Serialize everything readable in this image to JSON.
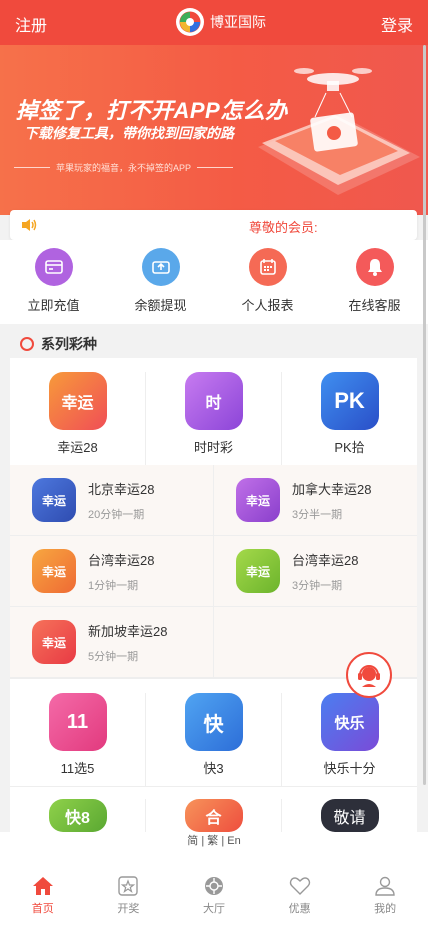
{
  "header": {
    "register": "注册",
    "title": "博亚国际",
    "login": "登录"
  },
  "banner": {
    "headline": "掉签了，打不开APP怎么办",
    "subline": "下载修复工具，带你找到回家的路",
    "tagline": "苹果玩家的福音，永不掉签的APP"
  },
  "notice": {
    "text": "尊敬的会员:"
  },
  "actions": [
    {
      "label": "立即充值",
      "icon": "recharge-icon",
      "color": "#b063e0"
    },
    {
      "label": "余额提现",
      "icon": "withdraw-icon",
      "color": "#5aa8ea"
    },
    {
      "label": "个人报表",
      "icon": "report-icon",
      "color": "#f56a55"
    },
    {
      "label": "在线客服",
      "icon": "service-icon",
      "color": "#f45a5a"
    }
  ],
  "section": {
    "title": "系列彩种"
  },
  "lottery_top": [
    {
      "name": "幸运28",
      "icon_text": "幸运",
      "color": "#f47b45"
    },
    {
      "name": "时时彩",
      "icon_text": "时",
      "color": "#a35de0"
    },
    {
      "name": "PK拾",
      "icon_text": "PK",
      "color": "#2f6fe0"
    }
  ],
  "lottery_sub": [
    [
      {
        "name": "北京幸运28",
        "desc": "20分钟一期",
        "icon_text": "幸运",
        "color": "#3c62c8"
      },
      {
        "name": "加拿大幸运28",
        "desc": "3分半一期",
        "icon_text": "幸运",
        "color": "#a455d6"
      }
    ],
    [
      {
        "name": "台湾幸运28",
        "desc": "1分钟一期",
        "icon_text": "幸运",
        "color": "#f28a3a"
      },
      {
        "name": "台湾幸运28",
        "desc": "3分钟一期",
        "icon_text": "幸运",
        "color": "#8cc63f"
      }
    ],
    [
      {
        "name": "新加坡幸运28",
        "desc": "5分钟一期",
        "icon_text": "幸运",
        "color": "#f2524a"
      }
    ]
  ],
  "lottery_bottom": [
    {
      "name": "11选5",
      "icon_text": "11",
      "color": "#ef4a8e"
    },
    {
      "name": "快3",
      "icon_text": "快",
      "color": "#3a8be8"
    },
    {
      "name": "快乐十分",
      "icon_text": "快乐",
      "color": "#3c6ae0"
    }
  ],
  "lottery_partial": [
    {
      "icon_text": "快8",
      "color": "#6cbd3a"
    },
    {
      "icon_text": "合",
      "color": "#f0674a"
    },
    {
      "icon_text": "敬请",
      "color": "#2d2f3a"
    }
  ],
  "language": "简 | 繁 | En",
  "tabs": [
    {
      "label": "首页",
      "icon": "home-icon",
      "active": true
    },
    {
      "label": "开奖",
      "icon": "star-icon",
      "active": false
    },
    {
      "label": "大厅",
      "icon": "hall-icon",
      "active": false
    },
    {
      "label": "优惠",
      "icon": "heart-icon",
      "active": false
    },
    {
      "label": "我的",
      "icon": "user-icon",
      "active": false
    }
  ],
  "colors": {
    "brand": "#f04a3d",
    "accent_text": "#f04a3d"
  }
}
